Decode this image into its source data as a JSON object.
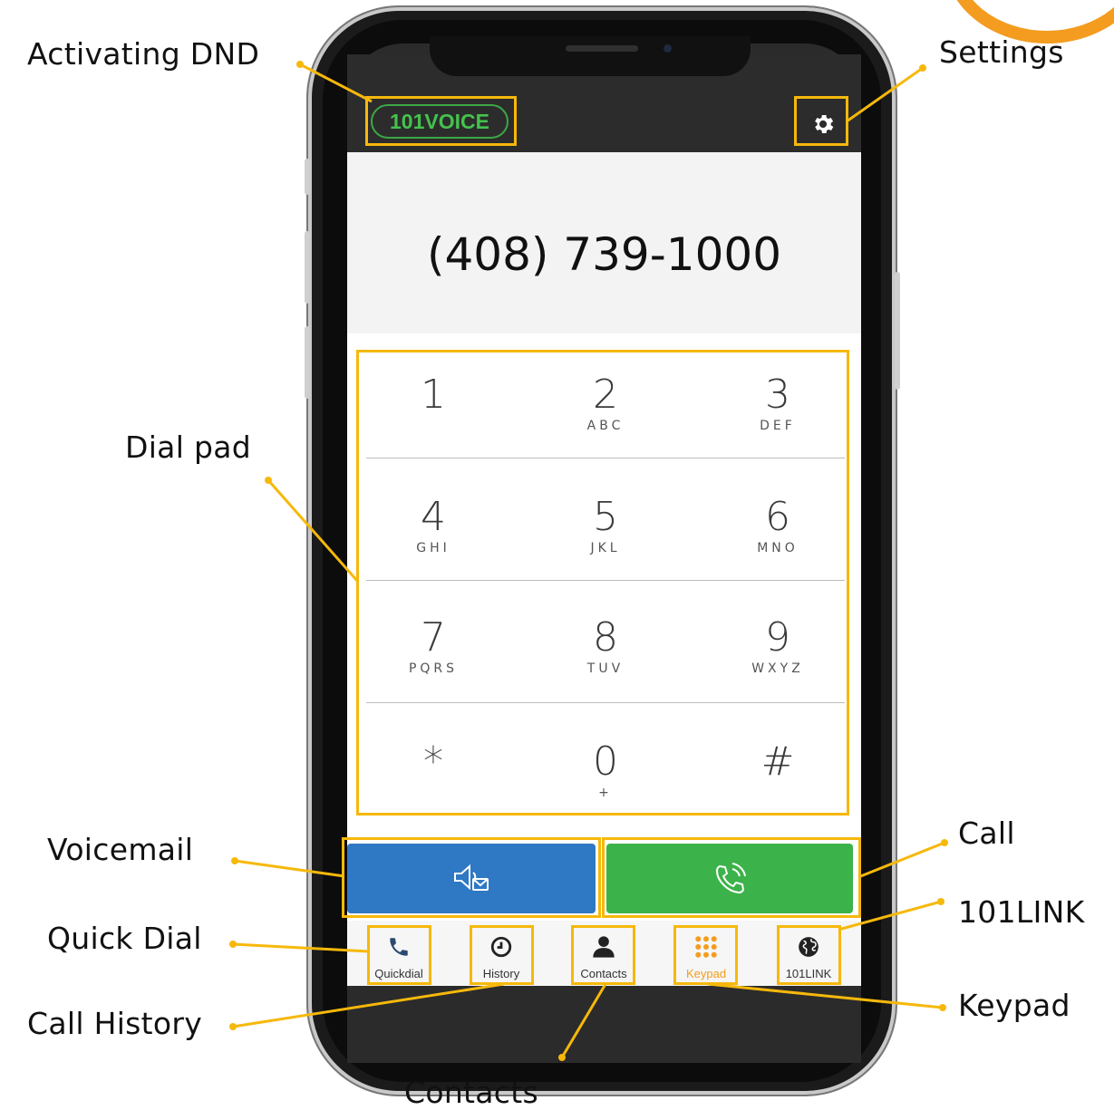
{
  "colors": {
    "highlight": "#f6b80b",
    "voicemail_button": "#2f78c4",
    "call_button": "#3cb34a",
    "brand_green": "#44c24d",
    "keypad_active": "#f39c1f"
  },
  "callouts": {
    "activating_dnd": "Activating DND",
    "settings": "Settings",
    "dial_pad": "Dial pad",
    "voicemail": "Voicemail",
    "call": "Call",
    "link101": "101LINK",
    "quick_dial": "Quick Dial",
    "keypad": "Keypad",
    "call_history": "Call History",
    "contacts": "Contacts"
  },
  "app": {
    "brand": "101VOICE",
    "settings_icon": "gear-icon",
    "phone_number": "(408) 739-1000"
  },
  "dialpad": {
    "keys": [
      {
        "digit": "1",
        "letters": ""
      },
      {
        "digit": "2",
        "letters": "ABC"
      },
      {
        "digit": "3",
        "letters": "DEF"
      },
      {
        "digit": "4",
        "letters": "GHI"
      },
      {
        "digit": "5",
        "letters": "JKL"
      },
      {
        "digit": "6",
        "letters": "MNO"
      },
      {
        "digit": "7",
        "letters": "PQRS"
      },
      {
        "digit": "8",
        "letters": "TUV"
      },
      {
        "digit": "9",
        "letters": "WXYZ"
      },
      {
        "digit": "*",
        "letters": ""
      },
      {
        "digit": "0",
        "letters": "+"
      },
      {
        "digit": "#",
        "letters": ""
      }
    ]
  },
  "actions": {
    "voicemail_icon": "voicemail-icon",
    "call_icon": "phone-icon"
  },
  "tabs": [
    {
      "label": "Quickdial",
      "icon": "phone-icon",
      "active": false
    },
    {
      "label": "History",
      "icon": "clock-icon",
      "active": false
    },
    {
      "label": "Contacts",
      "icon": "person-icon",
      "active": false
    },
    {
      "label": "Keypad",
      "icon": "keypad-grid-icon",
      "active": true
    },
    {
      "label": "101LINK",
      "icon": "globe-icon",
      "active": false
    }
  ]
}
